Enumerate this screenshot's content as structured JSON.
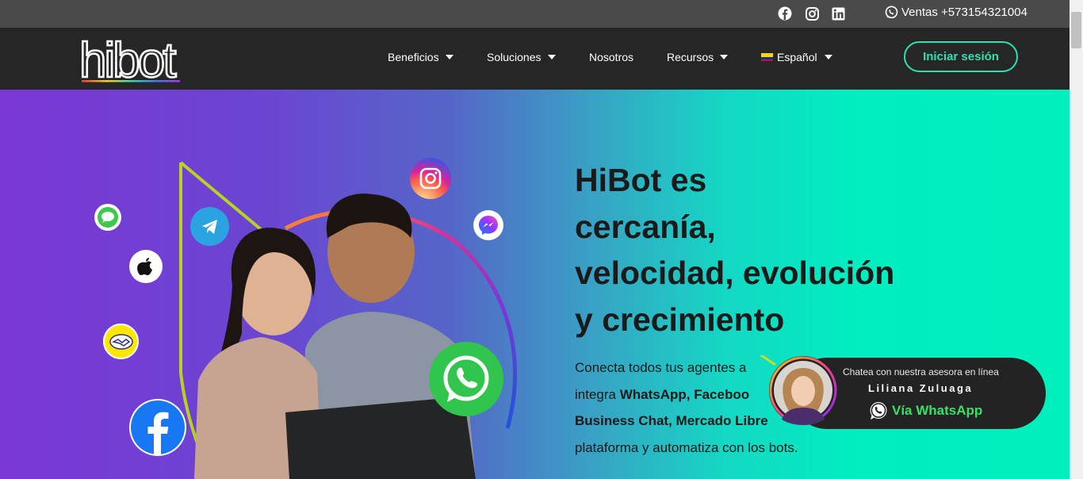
{
  "topbar": {
    "social_icons": [
      "facebook-icon",
      "instagram-icon",
      "linkedin-icon"
    ],
    "phone_label": "Ventas +573154321004"
  },
  "navbar": {
    "logo_text": "hibot",
    "items": [
      {
        "label": "Beneficios",
        "has_caret": true
      },
      {
        "label": "Soluciones",
        "has_caret": true
      },
      {
        "label": "Nosotros",
        "has_caret": false
      },
      {
        "label": "Recursos",
        "has_caret": true
      },
      {
        "label": "Español",
        "has_caret": true
      }
    ],
    "login_label": "Iniciar sesión"
  },
  "hero": {
    "headline_lines": [
      "HiBot es",
      "cercanía,",
      "velocidad, evolución",
      "y crecimiento"
    ],
    "body": {
      "p1": "Conecta todos tus agentes a",
      "p2a": "integra ",
      "p2b": "WhatsApp, Faceboo",
      "p3": "Business Chat, Mercado Libre",
      "p4": "plataforma y automatiza con los bots."
    },
    "channel_icons": [
      "imessage-icon",
      "telegram-icon",
      "apple-icon",
      "mercadolibre-icon",
      "facebook-icon",
      "instagram-icon",
      "messenger-icon",
      "whatsapp-icon"
    ]
  },
  "whatsapp_widget": {
    "caption": "Chatea con nuestra asesora en línea",
    "agent_name": "Liliana Zuluaga",
    "cta": "Vía WhatsApp"
  },
  "colors": {
    "accent": "#2fe0b0",
    "navbar_bg": "#262626",
    "topbar_bg": "#4a4a4a",
    "whatsapp_green": "#38e06a"
  }
}
